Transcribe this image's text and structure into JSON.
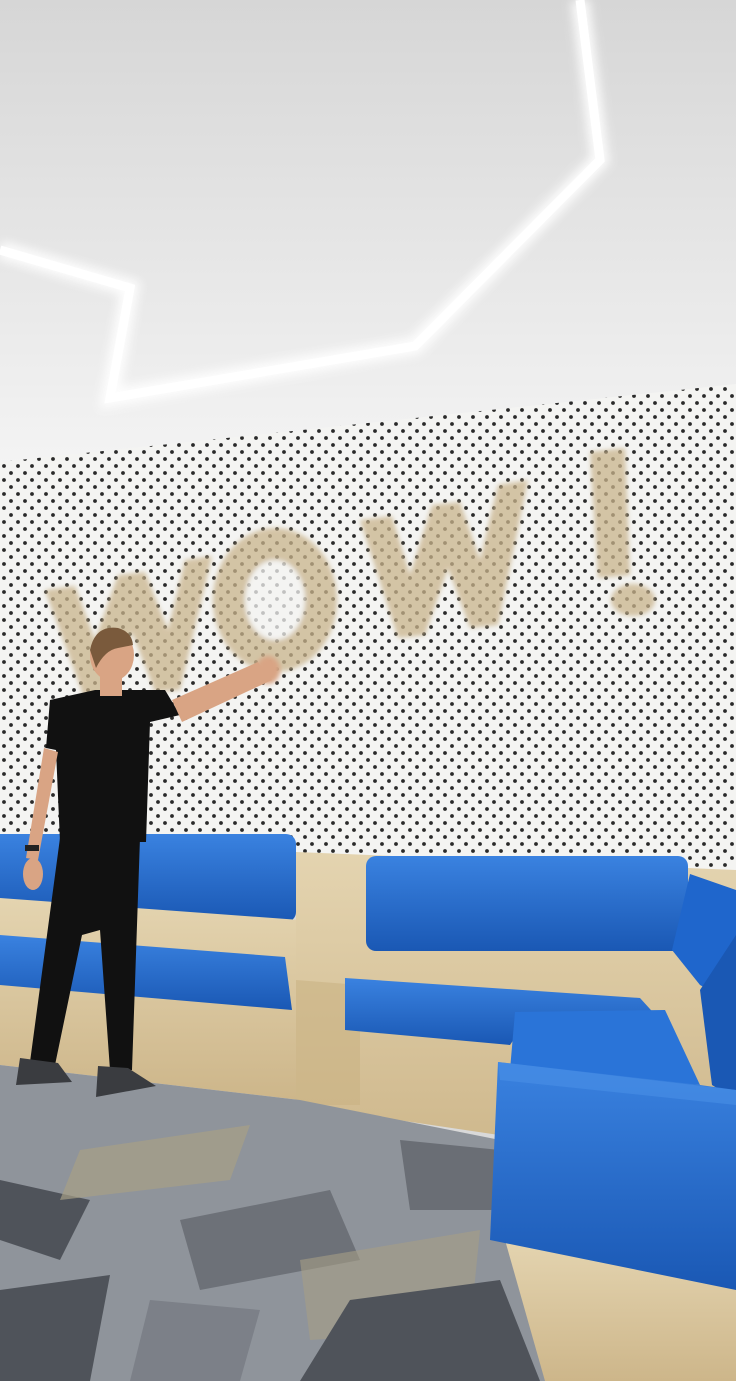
{
  "image": {
    "description_tags": [
      "ceiling",
      "led-light-strip",
      "pegboard-wall",
      "wall-lettering",
      "person",
      "bench-seating",
      "carpet"
    ],
    "wall_lettering": "WOW!"
  },
  "colors": {
    "ceiling": "#e6e6e6",
    "led_light": "#ffffff",
    "pegboard": "#f4f4f2",
    "peg_hole": "#2a2a2a",
    "wood": "#dcc9a2",
    "cushion": "#1d64c8",
    "cushion_highlight": "#3a82e0",
    "carpet_light": "#8f949b",
    "carpet_dark": "#4f535a",
    "carpet_tan": "#a79f86",
    "shirt": "#111111",
    "skin": "#d9a484"
  }
}
